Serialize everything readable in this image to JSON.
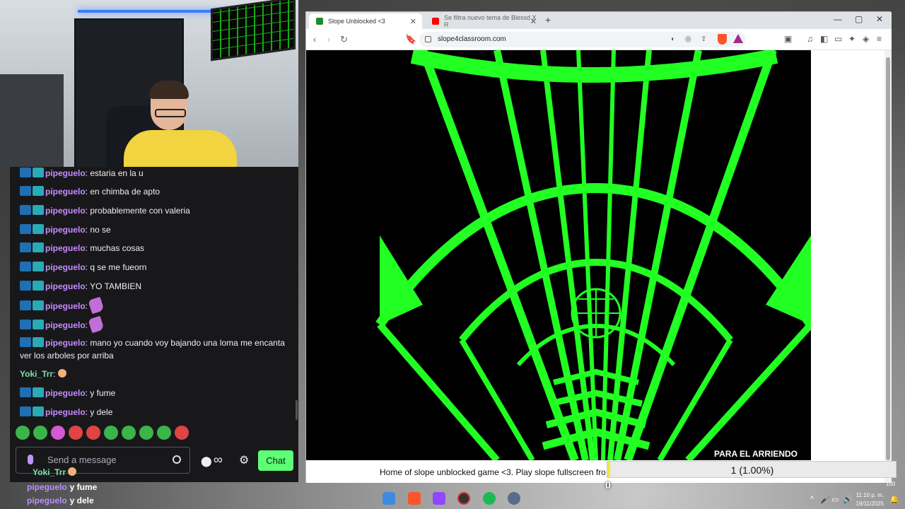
{
  "browser": {
    "tabs": [
      {
        "title": "Slope Unblocked <3",
        "active": true,
        "favicon_color": "#1e8c2a"
      },
      {
        "title": "Se filtra nuevo tema de Blessd X R",
        "active": false,
        "favicon_color": "#ff0000"
      }
    ],
    "url": "slope4classroom.com"
  },
  "page": {
    "caption": "Home of slope unblocked game <3. Play slope fullscreen fro"
  },
  "chat": {
    "messages": [
      {
        "user": "pipeguelo",
        "text": "estaria en la u",
        "badges": true
      },
      {
        "user": "pipeguelo",
        "text": "en chimba de apto",
        "badges": true
      },
      {
        "user": "pipeguelo",
        "text": "probablemente con valeria",
        "badges": true
      },
      {
        "user": "pipeguelo",
        "text": "no se",
        "badges": true
      },
      {
        "user": "pipeguelo",
        "text": "muchas cosas",
        "badges": true
      },
      {
        "user": "pipeguelo",
        "text": "q se me fueorn",
        "badges": true
      },
      {
        "user": "pipeguelo",
        "text": "YO TAMBIEN",
        "badges": true
      },
      {
        "user": "pipeguelo",
        "text": "",
        "badges": true,
        "emote": "emote-icon"
      },
      {
        "user": "pipeguelo",
        "text": "",
        "badges": true,
        "emote": "emote-icon"
      },
      {
        "user": "pipeguelo",
        "text": "mano yo cuando voy bajando una loma me encanta ver los arboles por arriba",
        "badges": true
      },
      {
        "user": "Yoki_Trr",
        "text": "",
        "badges": false,
        "emote": "face-emote-icon"
      },
      {
        "user": "pipeguelo",
        "text": "y fume",
        "badges": true
      },
      {
        "user": "pipeguelo",
        "text": "y dele",
        "badges": true
      }
    ],
    "input_placeholder": "Send a message",
    "chat_button": "Chat",
    "infinity": "∞"
  },
  "overlay": {
    "popup_user": "Yoki_Trr",
    "lines": [
      {
        "user": "pipeguelo",
        "text": "y fume"
      },
      {
        "user": "pipeguelo",
        "text": "y dele"
      }
    ],
    "goal_label": "PARA EL ARRIENDO",
    "goal_text": "1 (1.00%)",
    "goal_progress": 0.01,
    "goal_min": "0",
    "goal_max": "100"
  },
  "taskbar": {
    "time": "11:10 p. m.",
    "date": "19/11/2025"
  },
  "colors": {
    "game_green": "#22ff22",
    "chat_button": "#5cff75",
    "username": "#c78bff"
  }
}
